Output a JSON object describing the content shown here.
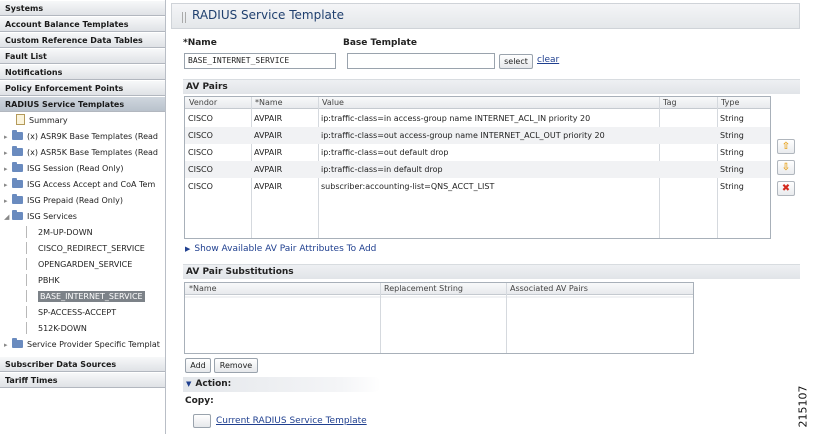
{
  "nav": {
    "sections_top": [
      "Systems",
      "Account Balance Templates",
      "Custom Reference Data Tables",
      "Fault List",
      "Notifications",
      "Policy Enforcement Points",
      "RADIUS Service Templates"
    ],
    "tree": [
      {
        "label": "Summary",
        "icon": "document-icon"
      },
      {
        "label": "(x) ASR9K Base Templates (Read",
        "icon": "folder-icon"
      },
      {
        "label": "(x) ASR5K Base Templates (Read",
        "icon": "folder-icon"
      },
      {
        "label": "ISG Session (Read Only)",
        "icon": "folder-icon"
      },
      {
        "label": "ISG Access Accept and CoA Tem",
        "icon": "folder-icon"
      },
      {
        "label": "ISG Prepaid (Read Only)",
        "icon": "folder-icon"
      },
      {
        "label": "ISG Services",
        "icon": "folder-open-icon"
      },
      {
        "label": "2M-UP-DOWN"
      },
      {
        "label": "CISCO_REDIRECT_SERVICE"
      },
      {
        "label": "OPENGARDEN_SERVICE"
      },
      {
        "label": "PBHK"
      },
      {
        "label": "BASE_INTERNET_SERVICE"
      },
      {
        "label": "SP-ACCESS-ACCEPT"
      },
      {
        "label": "512K-DOWN"
      },
      {
        "label": "Service Provider Specific Templat",
        "icon": "folder-icon"
      }
    ],
    "sections_bottom": [
      "Subscriber Data Sources",
      "Tariff Times"
    ]
  },
  "page": {
    "title": "RADIUS Service Template",
    "name_label": "*Name",
    "name_value": "BASE_INTERNET_SERVICE",
    "base_label": "Base Template",
    "base_value": "",
    "select_label": "select",
    "clear_label": "clear"
  },
  "av_pairs": {
    "header": "AV Pairs",
    "columns": [
      "Vendor",
      "*Name",
      "Value",
      "Tag",
      "Type"
    ],
    "rows": [
      {
        "vendor": "CISCO",
        "name": "AVPAIR",
        "value": "ip:traffic-class=in access-group name INTERNET_ACL_IN priority 20",
        "tag": "",
        "type": "String"
      },
      {
        "vendor": "CISCO",
        "name": "AVPAIR",
        "value": "ip:traffic-class=out access-group name INTERNET_ACL_OUT priority 20",
        "tag": "",
        "type": "String"
      },
      {
        "vendor": "CISCO",
        "name": "AVPAIR",
        "value": "ip:traffic-class=out default drop",
        "tag": "",
        "type": "String"
      },
      {
        "vendor": "CISCO",
        "name": "AVPAIR",
        "value": "ip:traffic-class=in default drop",
        "tag": "",
        "type": "String"
      },
      {
        "vendor": "CISCO",
        "name": "AVPAIR",
        "value": "subscriber:accounting-list=QNS_ACCT_LIST",
        "tag": "",
        "type": "String"
      }
    ],
    "show_link": "Show Available AV Pair Attributes To Add"
  },
  "substitutions": {
    "header": "AV Pair Substitutions",
    "columns": [
      "*Name",
      "Replacement String",
      "Associated AV Pairs"
    ],
    "add_label": "Add",
    "remove_label": "Remove"
  },
  "action": {
    "header": "Action:",
    "copy_label": "Copy:",
    "copy_link": "Current RADIUS Service Template"
  },
  "figure_number": "215107"
}
